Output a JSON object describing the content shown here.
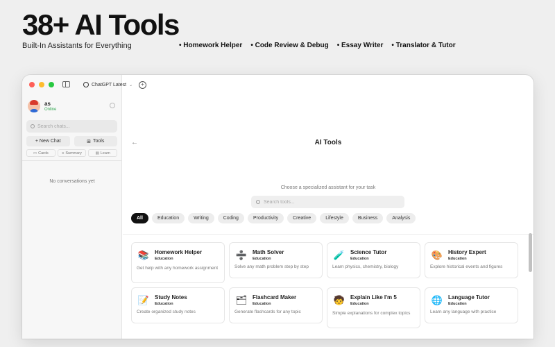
{
  "hero": {
    "title": "38+ AI Tools",
    "subtitle": "Built-In Assistants for Everything",
    "features": [
      "Homework Helper",
      "Code Review & Debug",
      "Essay Writer",
      "Translator & Tutor"
    ]
  },
  "titlebar": {
    "model": "ChatGPT Latest"
  },
  "sidebar": {
    "user_name": "as",
    "user_status": "Online",
    "search_placeholder": "Search chats...",
    "new_chat_label": "+ New Chat",
    "tools_label": "Tools",
    "mini": [
      "Cards",
      "Summary",
      "Learn"
    ],
    "empty_text": "No conversations yet"
  },
  "main": {
    "back_glyph": "←",
    "title": "AI Tools",
    "subtitle": "Choose a specialized assistant for your task",
    "search_placeholder": "Search tools...",
    "chips": [
      "All",
      "Education",
      "Writing",
      "Coding",
      "Productivity",
      "Creative",
      "Lifestyle",
      "Business",
      "Analysis"
    ],
    "active_chip": "All",
    "tools": [
      {
        "name": "Homework Helper",
        "category": "Education",
        "desc": "Get help with any homework assignment",
        "icon": "books-icon",
        "glyph": "📚"
      },
      {
        "name": "Math Solver",
        "category": "Education",
        "desc": "Solve any math problem step by step",
        "icon": "math-icon",
        "glyph": "➗"
      },
      {
        "name": "Science Tutor",
        "category": "Education",
        "desc": "Learn physics, chemistry, biology",
        "icon": "flask-icon",
        "glyph": "🧪"
      },
      {
        "name": "History Expert",
        "category": "Education",
        "desc": "Explore historical events and figures",
        "icon": "palette-icon",
        "glyph": "🎨"
      },
      {
        "name": "Study Notes",
        "category": "Education",
        "desc": "Create organized study notes",
        "icon": "notes-icon",
        "glyph": "📝"
      },
      {
        "name": "Flashcard Maker",
        "category": "Education",
        "desc": "Generate flashcards for any topic",
        "icon": "flashcard-icon",
        "glyph": "🗂"
      },
      {
        "name": "Explain Like I'm 5",
        "category": "Education",
        "desc": "Simple explanations for complex topics",
        "icon": "child-icon",
        "glyph": "🧒"
      },
      {
        "name": "Language Tutor",
        "category": "Education",
        "desc": "Learn any language with practice",
        "icon": "globe-icon",
        "glyph": "🌐"
      }
    ]
  },
  "colors": {
    "active_chip_bg": "#111111",
    "online": "#34a853",
    "traffic_red": "#fe5f57",
    "traffic_yellow": "#febc2e",
    "traffic_green": "#28c840"
  }
}
